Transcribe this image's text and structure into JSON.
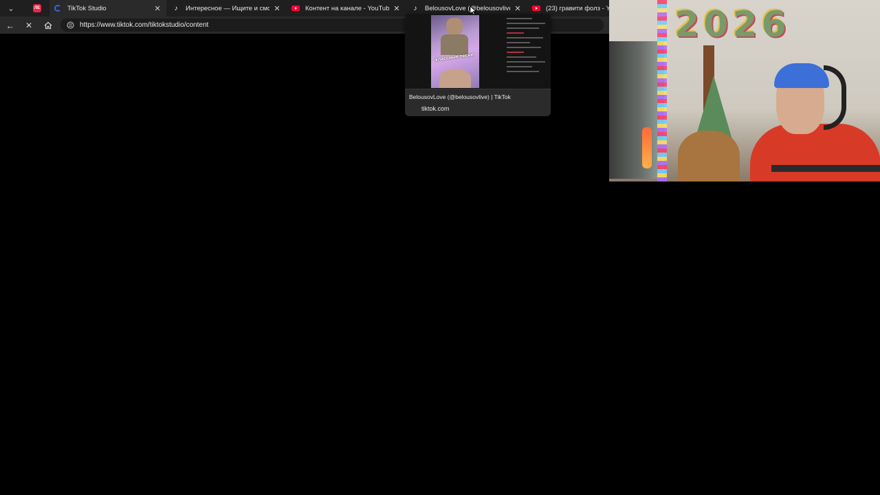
{
  "browser": {
    "tabs": [
      {
        "title": "TikTok Studio",
        "favicon": "tiktok-studio-icon",
        "active": true
      },
      {
        "title": "Интересное — Ищите и смотр",
        "favicon": "tiktok-icon",
        "active": false
      },
      {
        "title": "Контент на канале - YouTube S",
        "favicon": "youtube-icon",
        "active": false
      },
      {
        "title": "BelousovLove (@belousovlive) |",
        "favicon": "tiktok-icon",
        "active": false
      },
      {
        "title": "(23) гравити фолз - You",
        "favicon": "youtube-icon",
        "active": false
      }
    ],
    "pinned_tab_label": "ЛЕ",
    "address_bar": {
      "url": "https://www.tiktok.com/tiktokstudio/content"
    },
    "page_loading": true,
    "accent_colors": {
      "youtube": "#ff0033",
      "pinned": "#e4284c"
    }
  },
  "hover_card": {
    "title": "BelousovLove (@belousovlive) | TikTok",
    "domain": "tiktok.com",
    "thumbnail_caption": "классные песни"
  },
  "webcam": {
    "decoration_text": "2026"
  }
}
